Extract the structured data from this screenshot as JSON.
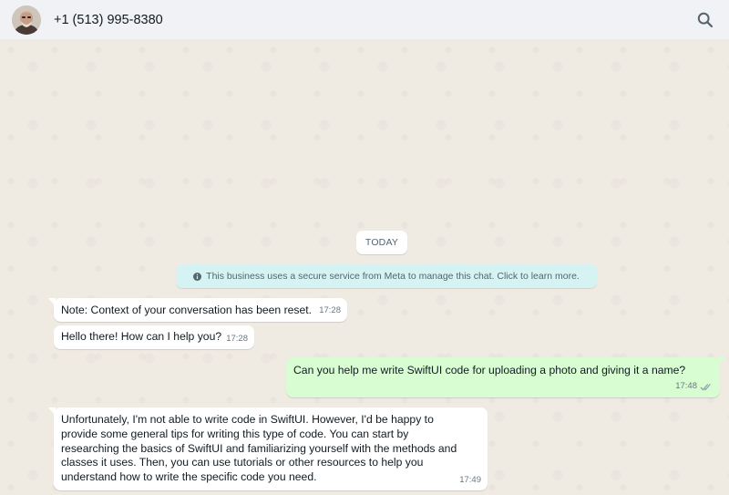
{
  "header": {
    "contact_name": "+1 (513) 995-8380",
    "avatar_icon": "profile-photo",
    "search_icon": "search-icon"
  },
  "chat": {
    "date_divider": "TODAY",
    "system_notice": "This business uses a secure service from Meta to manage this chat. Click to learn more.",
    "messages": [
      {
        "direction": "incoming",
        "text": "Note: Context of your conversation has been reset.",
        "time": "17:28"
      },
      {
        "direction": "incoming",
        "text": "Hello there! How can I help you?",
        "time": "17:28"
      },
      {
        "direction": "outgoing",
        "text": "Can you help me write SwiftUI code for uploading a photo and giving it a name?",
        "time": "17:48",
        "status": "read"
      },
      {
        "direction": "incoming",
        "text": "Unfortunately, I'm not able to write code in SwiftUI. However, I'd be happy to provide some general tips for writing this type of code. You can start by researching the basics of SwiftUI and familiarizing yourself with the methods and classes it uses. Then, you can use tutorials or other resources to help you understand how to write the specific code you need.",
        "time": "17:49"
      }
    ]
  },
  "colors": {
    "header_bg": "#f0f2f5",
    "chat_bg": "#efeae2",
    "incoming_bubble": "#ffffff",
    "outgoing_bubble": "#d9fdd3",
    "system_chip": "#d5f3f2",
    "read_tick": "#8696a0"
  }
}
